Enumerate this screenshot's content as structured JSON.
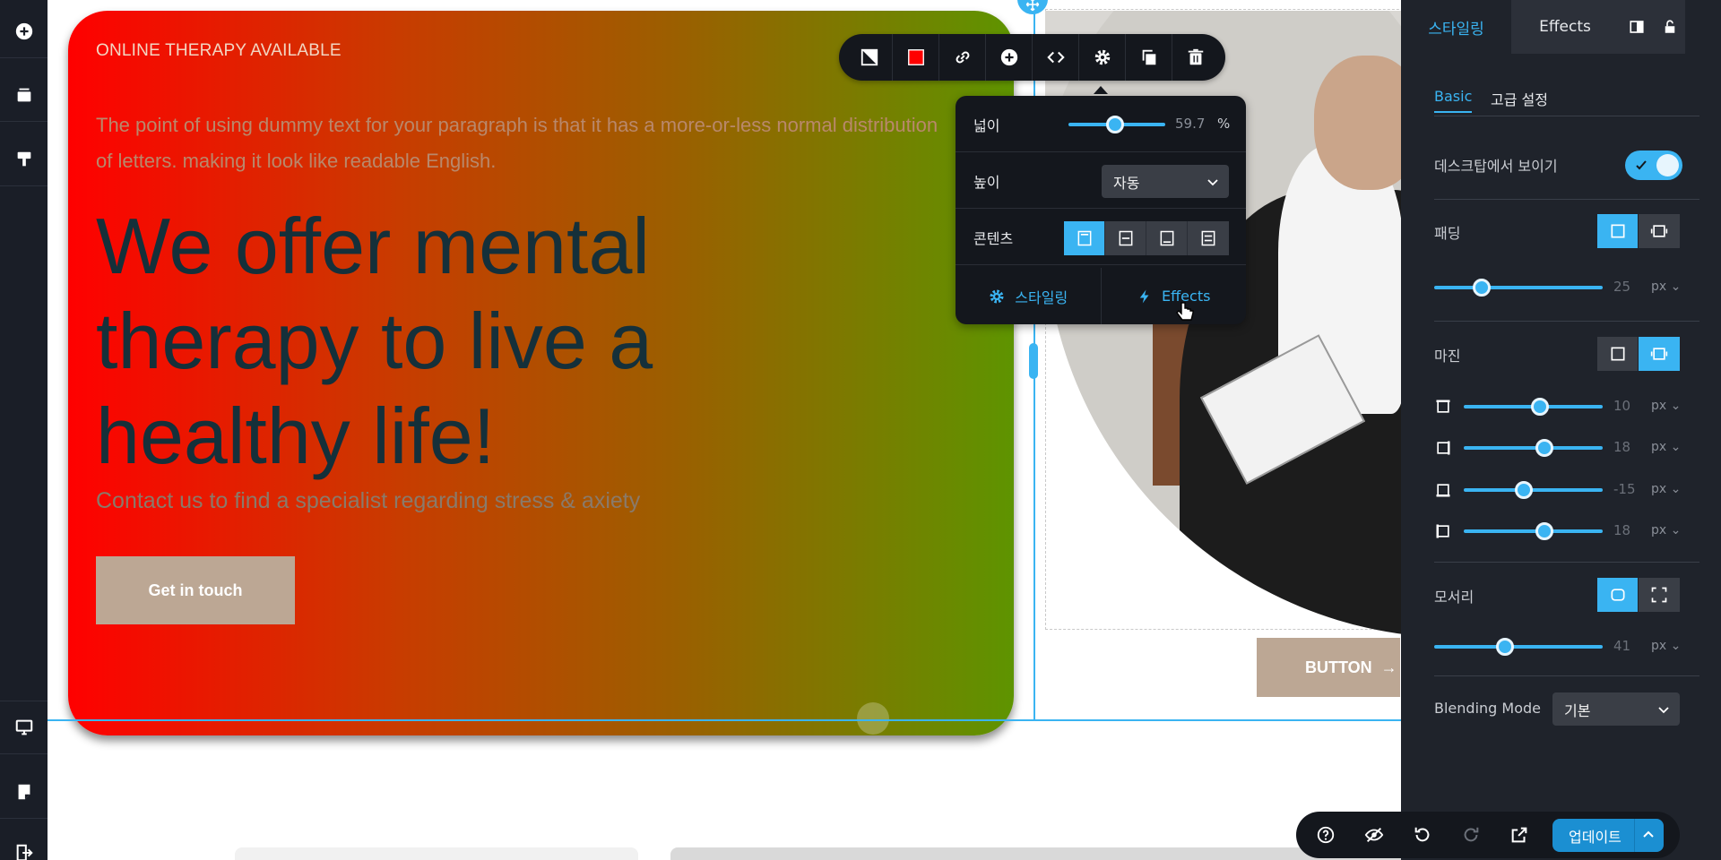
{
  "left_rail": {
    "items": [
      "add-icon",
      "layers-icon",
      "paint-icon",
      "desktop-icon",
      "page-icon",
      "exit-icon"
    ]
  },
  "hero": {
    "kicker": "ONLINE THERAPY AVAILABLE",
    "paragraph": "The point of using dummy text for your paragraph is that it has a more-or-less normal distribution of letters. making it look like readable English.",
    "title": "We offer mental therapy to live a healthy life!",
    "subtitle": "Contact us to find a specialist regarding stress & axiety",
    "cta": "Get in touch"
  },
  "photo_section": {
    "button_label": "BUTTON",
    "button_arrow": "→"
  },
  "toolbar": {
    "tools": [
      "contrast-icon",
      "color-swatch",
      "link-icon",
      "add-icon",
      "code-icon",
      "gear-icon",
      "duplicate-icon",
      "trash-icon"
    ],
    "swatch_color": "#ff0000"
  },
  "dim_popup": {
    "width_label": "넓이",
    "width_value": "59.7",
    "width_unit": "%",
    "width_fraction": 0.48,
    "height_label": "높이",
    "height_value": "자동",
    "content_label": "콘텐츠",
    "content_active_index": 0,
    "tab_style": "스타일링",
    "tab_effects": "Effects"
  },
  "right_panel": {
    "tab_style": "스타일링",
    "tab_effects": "Effects",
    "subtab_basic": "Basic",
    "subtab_advanced": "고급 설정",
    "desktop_visible_label": "데스크탑에서 보이기",
    "desktop_visible": true,
    "padding_label": "패딩",
    "padding_value": "25",
    "padding_fraction": 0.28,
    "margin_label": "마진",
    "margins": [
      {
        "value": "10",
        "fraction": 0.55
      },
      {
        "value": "18",
        "fraction": 0.58
      },
      {
        "value": "-15",
        "fraction": 0.43
      },
      {
        "value": "18",
        "fraction": 0.58
      }
    ],
    "corner_label": "모서리",
    "corner_value": "41",
    "corner_fraction": 0.42,
    "unit": "px",
    "blend_label": "Blending Mode",
    "blend_value": "기본"
  },
  "bottom_bar": {
    "tools": [
      "help-icon",
      "hide-icon",
      "undo-icon",
      "redo-icon",
      "external-link-icon"
    ],
    "publish_label": "업데이트"
  },
  "colors": {
    "accent": "#3ab4f2",
    "panel": "#1f232b",
    "dark": "#14171d",
    "cta": "#bca794"
  }
}
